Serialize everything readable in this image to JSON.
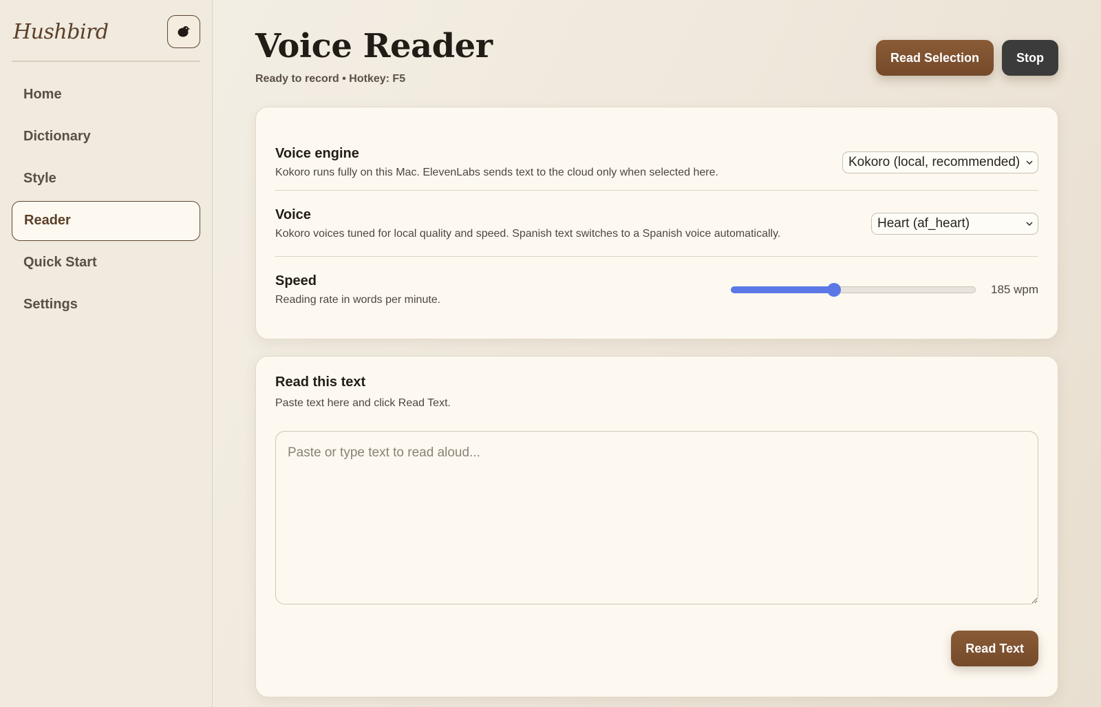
{
  "sidebar": {
    "logo": "Hushbird",
    "bird_icon": "bird-icon",
    "items": [
      {
        "label": "Home"
      },
      {
        "label": "Dictionary"
      },
      {
        "label": "Style"
      },
      {
        "label": "Reader",
        "active": true
      },
      {
        "label": "Quick Start"
      },
      {
        "label": "Settings"
      }
    ]
  },
  "header": {
    "title": "Voice Reader",
    "status": "Ready to record • Hotkey: F5",
    "read_selection_label": "Read Selection",
    "stop_label": "Stop"
  },
  "settings": {
    "engine": {
      "title": "Voice engine",
      "description": "Kokoro runs fully on this Mac. ElevenLabs sends text to the cloud only when selected here.",
      "selected": "Kokoro (local, recommended)"
    },
    "voice": {
      "title": "Voice",
      "description": "Kokoro voices tuned for local quality and speed. Spanish text switches to a Spanish voice automatically.",
      "selected": "Heart (af_heart)"
    },
    "speed": {
      "title": "Speed",
      "description": "Reading rate in words per minute.",
      "value_label": "185 wpm",
      "slider_fraction": 0.42
    }
  },
  "reader": {
    "title": "Read this text",
    "description": "Paste text here and click Read Text.",
    "placeholder": "Paste or type text to read aloud...",
    "value": "",
    "read_text_label": "Read Text"
  },
  "colors": {
    "accent_brown": "#7f5331",
    "slider_blue": "#5b78e6",
    "stop_dark": "#3b3b3b",
    "card_bg": "#fdf9f1"
  }
}
